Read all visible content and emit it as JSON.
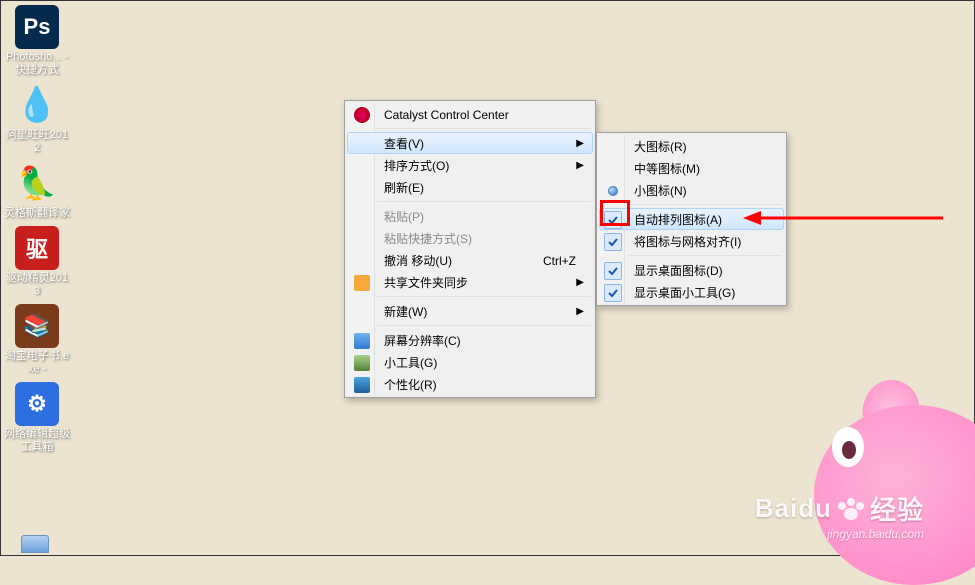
{
  "desktop_icons": [
    {
      "name": "photoshop",
      "label": "Photosho... - 快捷方式",
      "bg": "#062a4e",
      "glyph": "Ps"
    },
    {
      "name": "aliwangwang",
      "label": "阿里旺旺2012",
      "bg": "#2aa8f2",
      "glyph": "💧"
    },
    {
      "name": "lingoes",
      "label": "灵格斯翻译家",
      "bg": "#3cc24a",
      "glyph": "🦜"
    },
    {
      "name": "driver-genius",
      "label": "驱动精灵2013",
      "bg": "#c81e1e",
      "glyph": "驱"
    },
    {
      "name": "taobao-ebook",
      "label": "淘宝电子书.exe -",
      "bg": "#7a3b1a",
      "glyph": "📚"
    },
    {
      "name": "web-editor",
      "label": "网络编辑超级工具箱",
      "bg": "#2d6fe0",
      "glyph": "⚙"
    }
  ],
  "context_menu": {
    "items": [
      {
        "key": "ccc",
        "label": "Catalyst Control Center",
        "icon": "ccc-icon"
      },
      {
        "sep": true
      },
      {
        "key": "view",
        "label": "查看(V)",
        "submenu": true,
        "hover": true
      },
      {
        "key": "sort",
        "label": "排序方式(O)",
        "submenu": true
      },
      {
        "key": "refresh",
        "label": "刷新(E)"
      },
      {
        "sep": true
      },
      {
        "key": "paste",
        "label": "粘贴(P)",
        "disabled": true
      },
      {
        "key": "paste-sc",
        "label": "粘贴快捷方式(S)",
        "disabled": true
      },
      {
        "key": "undo-move",
        "label": "撤消 移动(U)",
        "hotkey": "Ctrl+Z",
        "icon": "undo-icon"
      },
      {
        "key": "sync",
        "label": "共享文件夹同步",
        "submenu": true,
        "icon": "sync-icon"
      },
      {
        "sep": true
      },
      {
        "key": "new",
        "label": "新建(W)",
        "submenu": true
      },
      {
        "sep": true
      },
      {
        "key": "resolution",
        "label": "屏幕分辨率(C)",
        "icon": "monitor-icon"
      },
      {
        "key": "gadgets",
        "label": "小工具(G)",
        "icon": "gadget-icon"
      },
      {
        "key": "personalize",
        "label": "个性化(R)",
        "icon": "personalize-icon"
      }
    ]
  },
  "view_submenu": {
    "items": [
      {
        "key": "large-icons",
        "label": "大图标(R)"
      },
      {
        "key": "medium-icons",
        "label": "中等图标(M)"
      },
      {
        "key": "small-icons",
        "label": "小图标(N)",
        "radio": true
      },
      {
        "sep": true
      },
      {
        "key": "auto-arrange",
        "label": "自动排列图标(A)",
        "checked": true,
        "hover": true,
        "highlight": true
      },
      {
        "key": "align-grid",
        "label": "将图标与网格对齐(I)",
        "checked": true
      },
      {
        "sep": true
      },
      {
        "key": "show-icons",
        "label": "显示桌面图标(D)",
        "checked": true
      },
      {
        "key": "show-gadgets",
        "label": "显示桌面小工具(G)",
        "checked": true
      }
    ]
  },
  "watermark": {
    "brand": "Baidu",
    "suffix": "经验",
    "url": "jingyan.baidu.com"
  },
  "annotation": {
    "arrow_color": "#ff0000"
  }
}
